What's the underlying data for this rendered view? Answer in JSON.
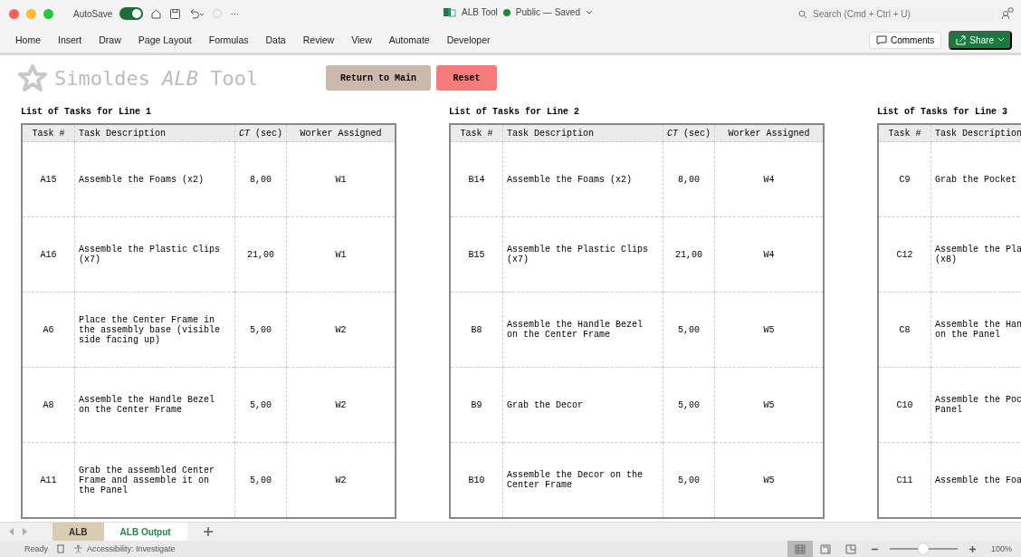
{
  "title_bar": {
    "autosave_label": "AutoSave",
    "autosave_on": true,
    "more": "···",
    "doc_title": "ALB Tool",
    "doc_status": "Public — Saved",
    "search_placeholder": "Search (Cmd + Ctrl + U)"
  },
  "ribbon": {
    "tabs": [
      "Home",
      "Insert",
      "Draw",
      "Page Layout",
      "Formulas",
      "Data",
      "Review",
      "View",
      "Automate",
      "Developer"
    ],
    "comments": "Comments",
    "share": "Share"
  },
  "sheet": {
    "app_title": {
      "name": "Simoldes",
      "italic": "ALB",
      "rest": "Tool"
    },
    "buttons": [
      {
        "label": "Return to Main",
        "kind": "main"
      },
      {
        "label": "Reset",
        "kind": "reset"
      }
    ],
    "tables": [
      {
        "title": "List of Tasks for Line 1",
        "columns_all": [
          "Task #",
          "Task Description",
          "*CT* (sec)",
          "Worker Assigned"
        ],
        "rows": [
          [
            "A15",
            "Assemble the Foams (x2)",
            "8,00",
            "W1"
          ],
          [
            "A16",
            "Assemble the Plastic Clips (x7)",
            "21,00",
            "W1"
          ],
          [
            "A6",
            "Place the Center Frame in the assembly base (visible side facing up)",
            "5,00",
            "W2"
          ],
          [
            "A8",
            "Assemble the Handle Bezel on the Center Frame",
            "5,00",
            "W2"
          ],
          [
            "A11",
            "Grab the assembled Center Frame and assemble it on the Panel",
            "5,00",
            "W2"
          ]
        ]
      },
      {
        "title": "List of Tasks for Line 2",
        "columns_all": [
          "Task #",
          "Task Description",
          "*CT* (sec)",
          "Worker Assigned"
        ],
        "rows": [
          [
            "B14",
            "Assemble the Foams (x2)",
            "8,00",
            "W4"
          ],
          [
            "B15",
            "Assemble the Plastic Clips (x7)",
            "21,00",
            "W4"
          ],
          [
            "B8",
            "Assemble the Handle Bezel on the Center Frame",
            "5,00",
            "W5"
          ],
          [
            "B9",
            "Grab the Decor",
            "5,00",
            "W5"
          ],
          [
            "B10",
            "Assemble the Decor on the Center Frame",
            "5,00",
            "W5"
          ]
        ]
      },
      {
        "title": "List of Tasks for Line 3",
        "columns_all": [
          "Task #",
          "Task Description"
        ],
        "rows": [
          [
            "C9",
            "Grab the Pocket"
          ],
          [
            "C12",
            "Assemble the Pla\n(x8)"
          ],
          [
            "C8",
            "Assemble the Han\non the Panel"
          ],
          [
            "C10",
            "Assemble the Poc\nPanel"
          ],
          [
            "C11",
            "Assemble the Foa"
          ]
        ]
      }
    ]
  },
  "sheet_tabs": [
    {
      "label": "ALB",
      "selected": false,
      "color": "#d9ccb2"
    },
    {
      "label": "ALB Output",
      "selected": true
    }
  ],
  "status_bar": {
    "ready": "Ready",
    "accessibility": "Accessibility: Investigate",
    "zoom": "100%",
    "zoom_slider": {
      "level": 0.5
    }
  }
}
